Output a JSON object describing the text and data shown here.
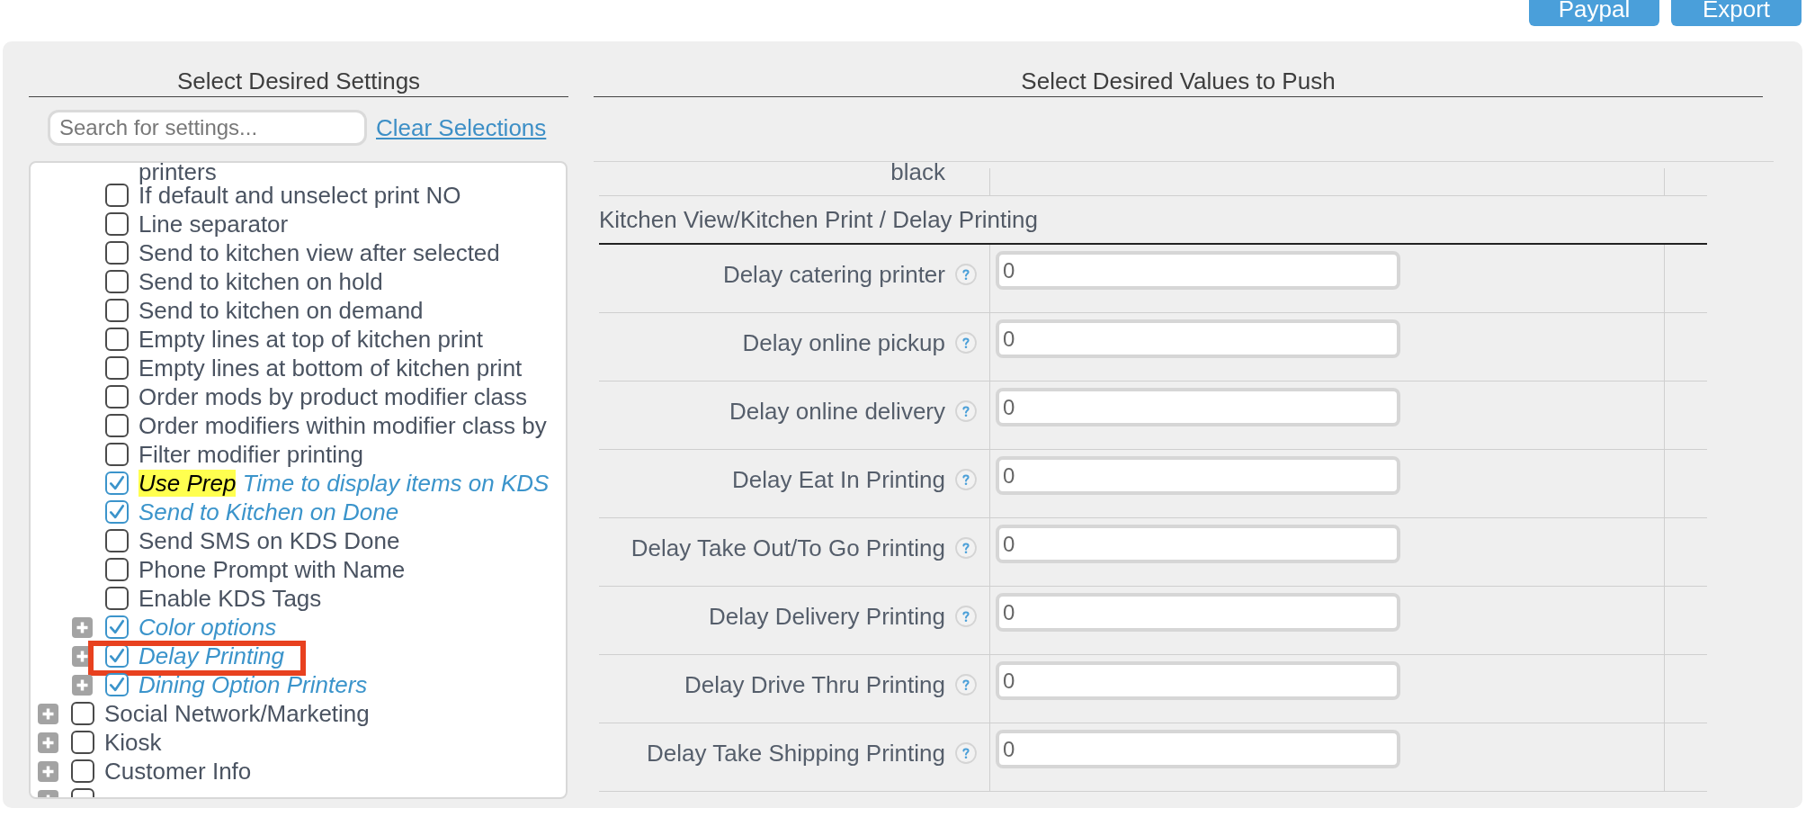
{
  "header_buttons": [
    {
      "label": "Paypal"
    },
    {
      "label": "Export"
    }
  ],
  "settings_panel": {
    "title": "Select Desired Settings",
    "search": {
      "placeholder": "Search for settings..."
    },
    "clear_link": "Clear Selections",
    "tree": [
      {
        "kind": "group",
        "children": [
          {
            "kind": "continuation",
            "label": "printers"
          },
          {
            "kind": "setting",
            "label": "If default and unselect print NO",
            "checked": false,
            "highlighted": false
          },
          {
            "kind": "setting",
            "label": "Line separator",
            "checked": false,
            "highlighted": false
          },
          {
            "kind": "setting",
            "label": "Send to kitchen view after selected",
            "checked": false,
            "highlighted": false
          },
          {
            "kind": "setting",
            "label": "Send to kitchen on hold",
            "checked": false,
            "highlighted": false
          },
          {
            "kind": "setting",
            "label": "Send to kitchen on demand",
            "checked": false,
            "highlighted": false
          },
          {
            "kind": "setting",
            "label": "Empty lines at top of kitchen print",
            "checked": false,
            "highlighted": false
          },
          {
            "kind": "setting",
            "label": "Empty lines at bottom of kitchen print",
            "checked": false,
            "highlighted": false
          },
          {
            "kind": "setting",
            "label": "Order mods by product modifier class",
            "checked": false,
            "highlighted": false
          },
          {
            "kind": "setting",
            "label": "Order modifiers within modifier class by",
            "checked": false,
            "highlighted": false
          },
          {
            "kind": "setting",
            "label": "Filter modifier printing",
            "checked": false,
            "highlighted": false
          },
          {
            "kind": "setting",
            "search_match": "Use Prep",
            "label": "Time to display items on KDS",
            "checked": true,
            "highlighted": false
          },
          {
            "kind": "setting",
            "label": "Send to Kitchen on Done",
            "checked": true,
            "highlighted": false
          },
          {
            "kind": "setting",
            "label": "Send SMS on KDS Done",
            "checked": false,
            "highlighted": false
          },
          {
            "kind": "setting",
            "label": "Phone Prompt with Name",
            "checked": false,
            "highlighted": false
          },
          {
            "kind": "setting",
            "label": "Enable KDS Tags",
            "checked": false,
            "highlighted": false
          },
          {
            "kind": "setting",
            "label": "Color options",
            "checked": true,
            "expanded": false,
            "highlighted": false
          },
          {
            "kind": "setting",
            "label": "Delay Printing",
            "checked": true,
            "expanded": false,
            "highlighted": true
          },
          {
            "kind": "setting",
            "label": "Dining Option Printers",
            "checked": true,
            "expanded": false,
            "highlighted": false
          }
        ]
      },
      {
        "kind": "setting",
        "label": "Social Network/Marketing",
        "checked": false,
        "expanded": false,
        "highlighted": false
      },
      {
        "kind": "setting",
        "label": "Kiosk",
        "checked": false,
        "expanded": false,
        "highlighted": false
      },
      {
        "kind": "setting",
        "label": "Customer Info",
        "checked": false,
        "expanded": false,
        "highlighted": false
      },
      {
        "kind": "setting",
        "checked": false,
        "expanded": false,
        "highlighted": false
      }
    ]
  },
  "values_panel": {
    "title": "Select Desired Values to Push",
    "rows": [
      {
        "kind": "partial",
        "label": "black"
      },
      {
        "kind": "section",
        "title": "Kitchen View/Kitchen Print / Delay Printing"
      },
      {
        "kind": "field",
        "label": "Delay catering printer",
        "value": "0"
      },
      {
        "kind": "field",
        "label": "Delay online pickup",
        "value": "0"
      },
      {
        "kind": "field",
        "label": "Delay online delivery",
        "value": "0"
      },
      {
        "kind": "field",
        "label": "Delay Eat In Printing",
        "value": "0"
      },
      {
        "kind": "field",
        "label": "Delay Take Out/To Go Printing",
        "value": "0"
      },
      {
        "kind": "field",
        "label": "Delay Delivery Printing",
        "value": "0"
      },
      {
        "kind": "field",
        "label": "Delay Drive Thru Printing",
        "value": "0"
      },
      {
        "kind": "field",
        "label": "Delay Take Shipping Printing",
        "value": "0"
      }
    ]
  }
}
